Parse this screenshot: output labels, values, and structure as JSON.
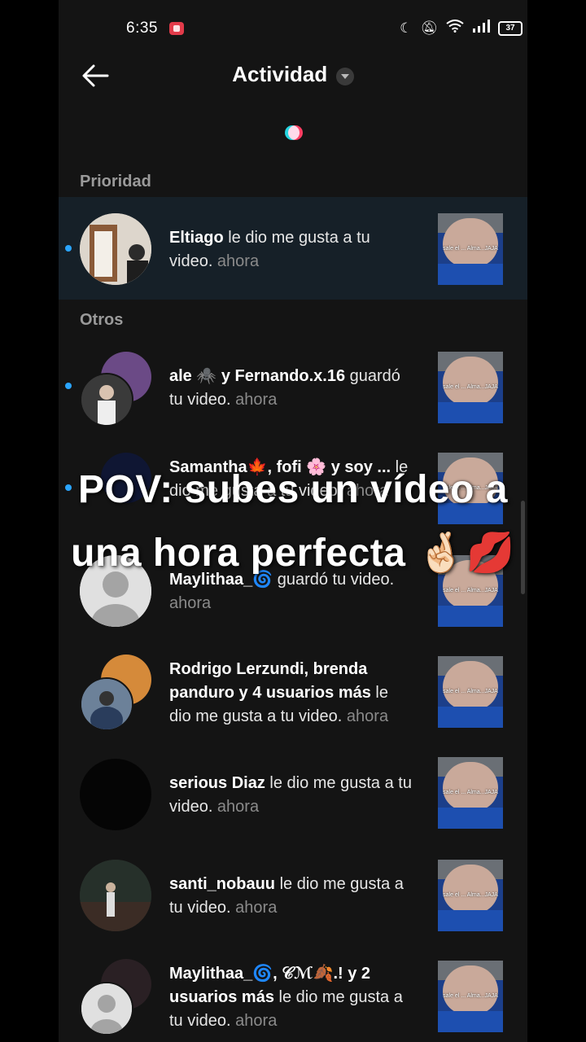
{
  "status_bar": {
    "time": "6:35",
    "battery": "37"
  },
  "header": {
    "title": "Actividad"
  },
  "sections": {
    "priority": "Prioridad",
    "others": "Otros"
  },
  "thumbnail_caption": "sale el ...\nAlma...JAJA",
  "notifications": [
    {
      "actor": "Eltiago",
      "action": " le dio me gusta a tu video.",
      "time": " ahora"
    },
    {
      "actor": "ale 🕷️ y Fernando.x.16",
      "action": " guardó tu video.",
      "time": " ahora"
    },
    {
      "actor": "Samantha🍁, fofi 🌸 y soy ...",
      "action": " le dio me gusta a tu video.",
      "time": " ahora"
    },
    {
      "actor": "Maylithaa_🌀",
      "action": " guardó tu video.",
      "time": " ahora"
    },
    {
      "actor": "Rodrigo Lerzundi, brenda panduro y 4 usuarios más",
      "action": " le dio me gusta a tu video.",
      "time": " ahora"
    },
    {
      "actor": "serious Diaz",
      "action": " le dio me gusta a tu video.",
      "time": " ahora"
    },
    {
      "actor": "santi_nobauu",
      "action": " le dio me gusta a tu video.",
      "time": " ahora"
    },
    {
      "actor": "Maylithaa_🌀, 𝒞ℳ🍂.! y 2 usuarios más",
      "action": " le dio me gusta a tu video.",
      "time": " ahora"
    }
  ],
  "overlay": {
    "line1": "POV: subes un vídeo a",
    "line2": "una hora perfecta 🤞🏻💋"
  }
}
